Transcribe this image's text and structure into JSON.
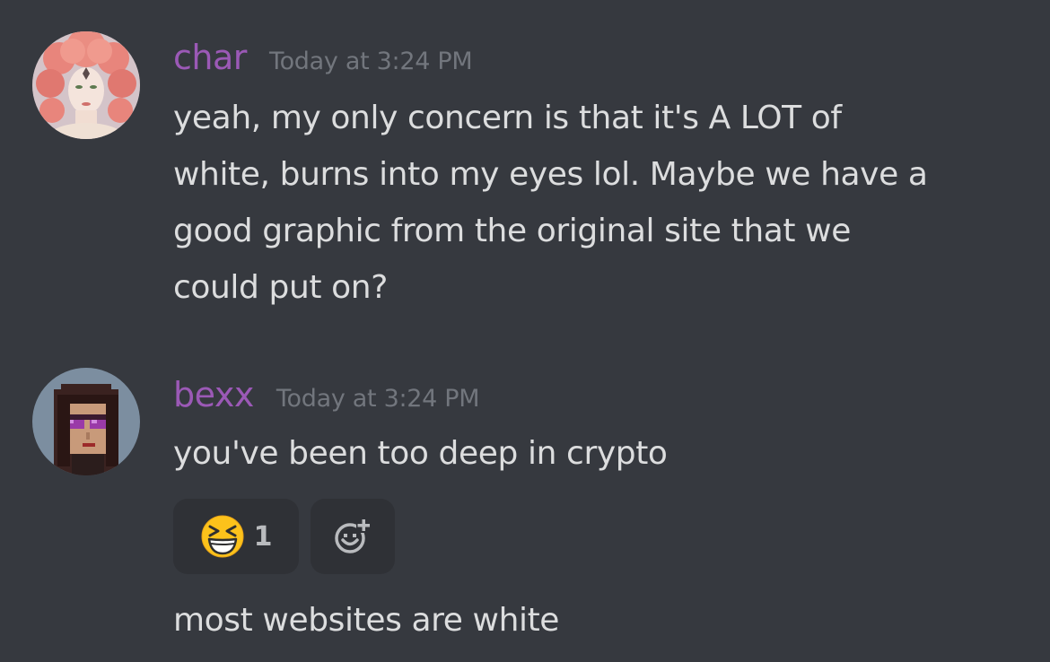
{
  "messages": [
    {
      "author": "char",
      "timestamp": "Today at 3:24 PM",
      "lines": [
        "yeah, my only concern is that it's A LOT of",
        "white, burns into my eyes lol. Maybe we have a",
        "good graphic from the original site that we",
        "could put on?"
      ]
    },
    {
      "author": "bexx",
      "timestamp": "Today at 3:24 PM",
      "text": "you've been too deep in crypto",
      "reactions": [
        {
          "emoji": "laughing-squinting-face",
          "count": "1"
        }
      ],
      "add_reaction_icon": "add-reaction-icon"
    },
    {
      "text": "most websites are white"
    }
  ],
  "colors": {
    "background": "#36393f",
    "username": "#9b59b6",
    "timestamp": "#72767d",
    "text": "#dcddde",
    "reaction_bg": "#2f3136"
  }
}
